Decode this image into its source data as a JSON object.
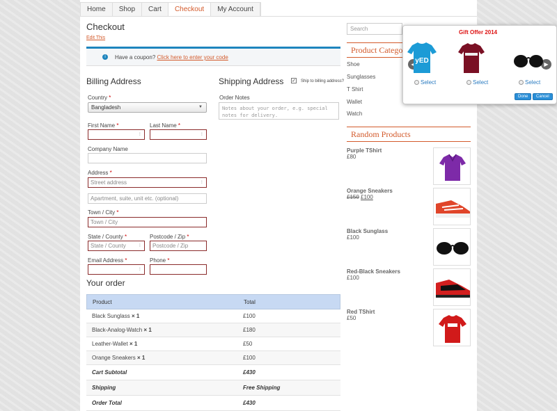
{
  "nav": {
    "items": [
      "Home",
      "Shop",
      "Cart",
      "Checkout",
      "My Account"
    ],
    "active": "Checkout"
  },
  "page": {
    "title": "Checkout",
    "edit_link": "Edit This"
  },
  "coupon": {
    "prefix": "Have a coupon?",
    "link": "Click here to enter your code",
    "icon": "info-icon"
  },
  "billing": {
    "title": "Billing Address",
    "country_label": "Country",
    "country_value": "Bangladesh",
    "first_name_label": "First Name",
    "last_name_label": "Last Name",
    "company_label": "Company Name",
    "address_label": "Address",
    "street_placeholder": "Street address",
    "apartment_placeholder": "Apartment, suite, unit etc. (optional)",
    "town_label": "Town / City",
    "town_placeholder": "Town / City",
    "state_label": "State / County",
    "state_placeholder": "State / County",
    "postcode_label": "Postcode / Zip",
    "postcode_placeholder": "Postcode / Zip",
    "email_label": "Email Address",
    "phone_label": "Phone",
    "required_mark": "*"
  },
  "shipping": {
    "title": "Shipping Address",
    "ship_to_billing_label": "Ship to billing address?",
    "ship_to_billing_checked": "✓",
    "order_notes_label": "Order Notes",
    "order_notes_placeholder": "Notes about your order, e.g. special notes for delivery."
  },
  "order": {
    "title": "Your order",
    "headers": [
      "Product",
      "Total"
    ],
    "items": [
      {
        "name": "Black Sunglass",
        "qty": "× 1",
        "total": "£100"
      },
      {
        "name": "Black-Analog-Watch",
        "qty": "× 1",
        "total": "£180"
      },
      {
        "name": "Leather-Wallet",
        "qty": "× 1",
        "total": "£50"
      },
      {
        "name": "Orange Sneakers",
        "qty": "× 1",
        "total": "£100"
      }
    ],
    "subtotal_label": "Cart Subtotal",
    "subtotal_value": "£430",
    "shipping_label": "Shipping",
    "shipping_value": "Free Shipping",
    "total_label": "Order Total",
    "total_value": "£430"
  },
  "sidebar": {
    "search_placeholder": "Search",
    "categories_title": "Product Catego",
    "categories": [
      "Shoe",
      "Sunglasses",
      "T Shirt",
      "Wallet",
      "Watch"
    ],
    "random_title": "Random Products",
    "random_products": [
      {
        "name": "Purple TShirt",
        "price": "£80",
        "icon": "purple-polo-shirt"
      },
      {
        "name": "Orange Sneakers",
        "old_price": "£150",
        "price": "£100",
        "icon": "orange-sneaker"
      },
      {
        "name": "Black Sunglass",
        "price": "£100",
        "icon": "black-sunglasses"
      },
      {
        "name": "Red-Black Sneakers",
        "price": "£100",
        "icon": "red-black-sneaker"
      },
      {
        "name": "Red TShirt",
        "price": "£50",
        "icon": "red-tshirt"
      }
    ]
  },
  "gift_popup": {
    "title": "Gift Offer 2014",
    "items": [
      {
        "icon": "blue-tshirt",
        "select_label": "Select"
      },
      {
        "icon": "maroon-tshirt",
        "select_label": "Select"
      },
      {
        "icon": "black-sunglasses",
        "select_label": "Select"
      }
    ],
    "done_label": "Done",
    "cancel_label": "Cancel",
    "prev_icon": "chevron-left-icon",
    "next_icon": "chevron-right-icon"
  },
  "colors": {
    "accent": "#d35a2b",
    "link_blue": "#2a7bc0",
    "table_header": "#c7d9f3",
    "gift_title": "#dd1111"
  }
}
